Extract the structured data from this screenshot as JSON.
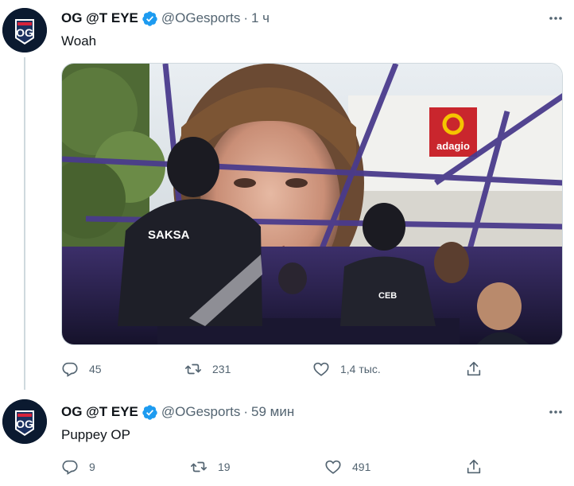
{
  "tweets": [
    {
      "display_name": "OG @T EYE",
      "handle": "@OGesports",
      "separator": "·",
      "time": "1 ч",
      "text": "Woah",
      "media": {
        "bg_sign": "adagio",
        "jersey_left": "SAKSA",
        "jersey_right": "CEB"
      },
      "reply_count": "45",
      "retweet_count": "231",
      "like_count": "1,4 тыс."
    },
    {
      "display_name": "OG @T EYE",
      "handle": "@OGesports",
      "separator": "·",
      "time": "59 мин",
      "text": "Puppey OP",
      "reply_count": "9",
      "retweet_count": "19",
      "like_count": "491"
    }
  ],
  "colors": {
    "verified": "#1d9bf0",
    "secondary_text": "#536471",
    "thread_line": "#cfd9de",
    "avatar_bg": "#0b1a30"
  },
  "icons": {
    "verified": "verified-badge-icon",
    "more": "more-dots-icon",
    "reply": "reply-icon",
    "retweet": "retweet-icon",
    "like": "heart-icon",
    "share": "share-icon"
  }
}
